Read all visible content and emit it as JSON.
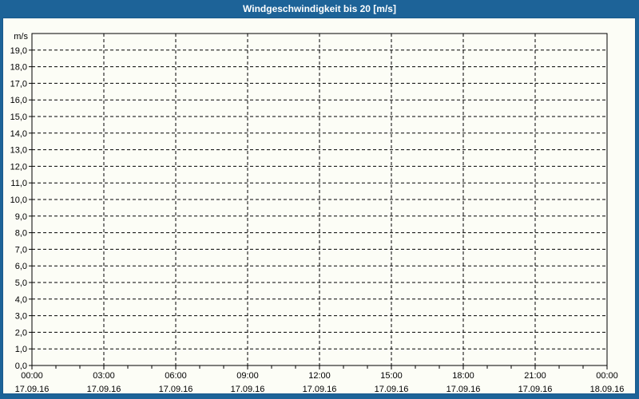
{
  "window": {
    "title": "Windgeschwindigkeit bis 20 [m/s]"
  },
  "colors": {
    "frame": "#1d6398",
    "title_text": "#ffffff",
    "content_bg": "#fcfdf6",
    "content_border": "#1a5a8c",
    "grid": "#000000",
    "label_text": "#000000"
  },
  "chart_data": {
    "type": "line",
    "title": "Windgeschwindigkeit bis 20 [m/s]",
    "grid": "dashed",
    "legend": "none",
    "series": [],
    "y_axis": {
      "unit": "m/s",
      "range": [
        0,
        20
      ],
      "tick_step": 1,
      "tick_labels": [
        "0,0",
        "1,0",
        "2,0",
        "3,0",
        "4,0",
        "5,0",
        "6,0",
        "7,0",
        "8,0",
        "9,0",
        "10,0",
        "11,0",
        "12,0",
        "13,0",
        "14,0",
        "15,0",
        "16,0",
        "17,0",
        "18,0",
        "19,0"
      ]
    },
    "x_axis": {
      "total_hours": 24,
      "major_every_hours": 3,
      "minor_every_hours": 1,
      "ticks": [
        {
          "time": "00:00",
          "date": "17.09.16"
        },
        {
          "time": "03:00",
          "date": "17.09.16"
        },
        {
          "time": "06:00",
          "date": "17.09.16"
        },
        {
          "time": "09:00",
          "date": "17.09.16"
        },
        {
          "time": "12:00",
          "date": "17.09.16"
        },
        {
          "time": "15:00",
          "date": "17.09.16"
        },
        {
          "time": "18:00",
          "date": "17.09.16"
        },
        {
          "time": "21:00",
          "date": "17.09.16"
        },
        {
          "time": "00:00",
          "date": "18.09.16"
        }
      ]
    }
  }
}
